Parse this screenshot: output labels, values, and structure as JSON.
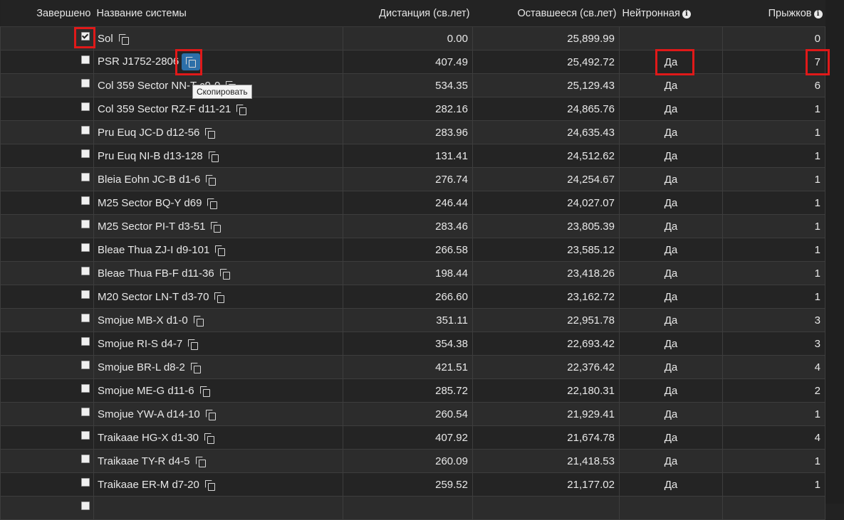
{
  "columns": {
    "completed": "Завершено",
    "system_name": "Название системы",
    "distance": "Дистанция (св.лет)",
    "remaining": "Оставшееся (св.лет)",
    "neutron": "Нейтронная",
    "jumps": "Прыжков"
  },
  "tooltip": "Скопировать",
  "rows": [
    {
      "done": true,
      "name": "Sol",
      "distance": "0.00",
      "remaining": "25,899.99",
      "neutron": "",
      "jumps": "0"
    },
    {
      "done": false,
      "name": "PSR J1752-2806",
      "distance": "407.49",
      "remaining": "25,492.72",
      "neutron": "Да",
      "jumps": "7"
    },
    {
      "done": false,
      "name": "Col 359 Sector NN-T c9-0",
      "distance": "534.35",
      "remaining": "25,129.43",
      "neutron": "Да",
      "jumps": "6"
    },
    {
      "done": false,
      "name": "Col 359 Sector RZ-F d11-21",
      "distance": "282.16",
      "remaining": "24,865.76",
      "neutron": "Да",
      "jumps": "1"
    },
    {
      "done": false,
      "name": "Pru Euq JC-D d12-56",
      "distance": "283.96",
      "remaining": "24,635.43",
      "neutron": "Да",
      "jumps": "1"
    },
    {
      "done": false,
      "name": "Pru Euq NI-B d13-128",
      "distance": "131.41",
      "remaining": "24,512.62",
      "neutron": "Да",
      "jumps": "1"
    },
    {
      "done": false,
      "name": "Bleia Eohn JC-B d1-6",
      "distance": "276.74",
      "remaining": "24,254.67",
      "neutron": "Да",
      "jumps": "1"
    },
    {
      "done": false,
      "name": "M25 Sector BQ-Y d69",
      "distance": "246.44",
      "remaining": "24,027.07",
      "neutron": "Да",
      "jumps": "1"
    },
    {
      "done": false,
      "name": "M25 Sector PI-T d3-51",
      "distance": "283.46",
      "remaining": "23,805.39",
      "neutron": "Да",
      "jumps": "1"
    },
    {
      "done": false,
      "name": "Bleae Thua ZJ-I d9-101",
      "distance": "266.58",
      "remaining": "23,585.12",
      "neutron": "Да",
      "jumps": "1"
    },
    {
      "done": false,
      "name": "Bleae Thua FB-F d11-36",
      "distance": "198.44",
      "remaining": "23,418.26",
      "neutron": "Да",
      "jumps": "1"
    },
    {
      "done": false,
      "name": "M20 Sector LN-T d3-70",
      "distance": "266.60",
      "remaining": "23,162.72",
      "neutron": "Да",
      "jumps": "1"
    },
    {
      "done": false,
      "name": "Smojue MB-X d1-0",
      "distance": "351.11",
      "remaining": "22,951.78",
      "neutron": "Да",
      "jumps": "3"
    },
    {
      "done": false,
      "name": "Smojue RI-S d4-7",
      "distance": "354.38",
      "remaining": "22,693.42",
      "neutron": "Да",
      "jumps": "3"
    },
    {
      "done": false,
      "name": "Smojue BR-L d8-2",
      "distance": "421.51",
      "remaining": "22,376.42",
      "neutron": "Да",
      "jumps": "4"
    },
    {
      "done": false,
      "name": "Smojue ME-G d11-6",
      "distance": "285.72",
      "remaining": "22,180.31",
      "neutron": "Да",
      "jumps": "2"
    },
    {
      "done": false,
      "name": "Smojue YW-A d14-10",
      "distance": "260.54",
      "remaining": "21,929.41",
      "neutron": "Да",
      "jumps": "1"
    },
    {
      "done": false,
      "name": "Traikaae HG-X d1-30",
      "distance": "407.92",
      "remaining": "21,674.78",
      "neutron": "Да",
      "jumps": "4"
    },
    {
      "done": false,
      "name": "Traikaae TY-R d4-5",
      "distance": "260.09",
      "remaining": "21,418.53",
      "neutron": "Да",
      "jumps": "1"
    },
    {
      "done": false,
      "name": "Traikaae ER-M d7-20",
      "distance": "259.52",
      "remaining": "21,177.02",
      "neutron": "Да",
      "jumps": "1"
    },
    {
      "done": false,
      "name": "",
      "distance": "",
      "remaining": "",
      "neutron": "",
      "jumps": ""
    }
  ],
  "colors": {
    "highlight": "#e01919",
    "copy_button_active": "#2d6fa8",
    "background": "#222222"
  }
}
